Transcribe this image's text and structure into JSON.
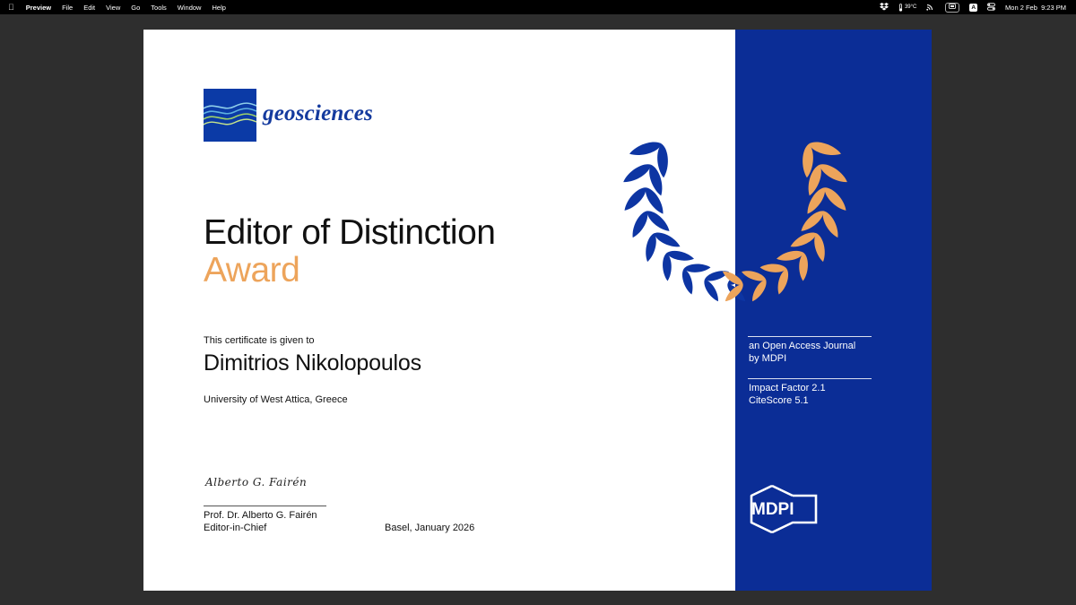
{
  "menubar": {
    "app_name": "Preview",
    "menus": [
      "File",
      "Edit",
      "View",
      "Go",
      "Tools",
      "Window",
      "Help"
    ],
    "temperature": "39°C",
    "keyboard_badge": "A",
    "datetime": "Mon 2 Feb  9:23 PM"
  },
  "certificate": {
    "journal_name": "geosciences",
    "title": "Editor of Distinction",
    "subtitle": "Award",
    "given_to_label": "This certificate is given to",
    "recipient": "Dimitrios Nikolopoulos",
    "affiliation": "University of West Attica, Greece",
    "signature_text": "Alberto G. Fairén",
    "signer_name": "Prof. Dr. Alberto G. Fairén",
    "signer_role": "Editor-in-Chief",
    "place_date": "Basel, January 2026"
  },
  "panel": {
    "journal_type_line1": "an Open Access Journal",
    "journal_type_line2": "by MDPI",
    "impact_factor": "Impact Factor 2.1",
    "citescore": "CiteScore 5.1",
    "publisher_logo": "MDPI"
  },
  "colors": {
    "brand_blue": "#0b2d96",
    "accent_orange": "#eda45b",
    "journal_blue": "#143a9e"
  }
}
